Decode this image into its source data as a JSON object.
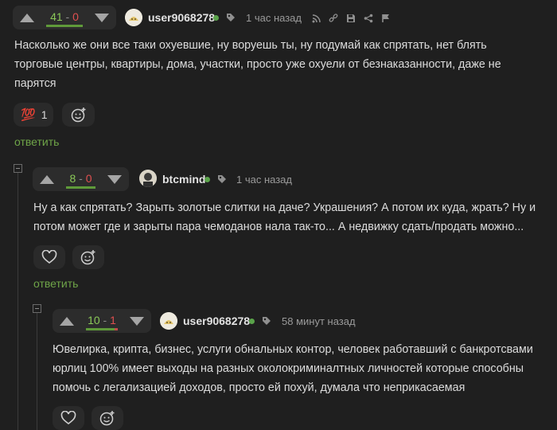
{
  "comments": [
    {
      "votes": {
        "plus": "41",
        "sep": "-",
        "minus": "0",
        "plus_fraction": 1.0
      },
      "author": "user9068278",
      "time": "1 час назад",
      "text": "Насколько же они все таки охуевшие, ну воруешь ты, ну подумай как спрятать, нет блять торговые центры, квартиры, дома, участки, просто уже охуели от безнаказанности, даже не парятся",
      "reaction": {
        "emoji": "💯",
        "count": "1"
      },
      "reply_label": "ответить"
    },
    {
      "votes": {
        "plus": "8",
        "sep": "-",
        "minus": "0",
        "plus_fraction": 1.0
      },
      "author": "btcmind",
      "time": "1 час назад",
      "text": "Ну а как спрятать? Зарыть золотые слитки на даче? Украшения? А потом их куда, жрать? Ну и потом может где и зарыты пара чемоданов нала так-то... А недвижку сдать/продать можно...",
      "reply_label": "ответить"
    },
    {
      "votes": {
        "plus": "10",
        "sep": "-",
        "minus": "1",
        "plus_fraction": 0.91
      },
      "author": "user9068278",
      "time": "58 минут назад",
      "text": "Ювелирка, крипта, бизнес, услуги обнальных контор, человек работавший с банкротсвами юрлиц 100% имеет выходы на разных околокриминалтных личностей которые способны помочь с легализацией доходов, просто ей похуй, думала что неприкасаемая"
    }
  ],
  "colors": {
    "background": "#1f1f1f",
    "accent_green": "#6fa548",
    "minus_red": "#e05050",
    "online": "#5aa34a"
  },
  "icons": [
    "arrow-up-icon",
    "arrow-down-icon",
    "tag-icon",
    "rss-icon",
    "link-icon",
    "save-icon",
    "share-icon",
    "flag-icon",
    "heart-icon",
    "add-reaction-icon",
    "collapse-icon"
  ]
}
